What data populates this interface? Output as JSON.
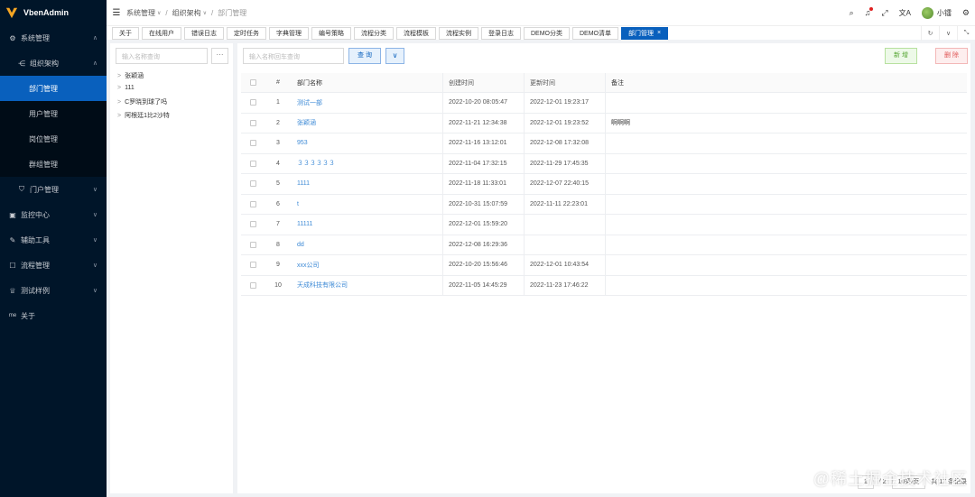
{
  "app": {
    "title": "VbenAdmin",
    "accent": "#0960bd",
    "sidebar_bg": "#001529"
  },
  "sidebar": {
    "items": [
      {
        "label": "系统管理",
        "icon": "gear-icon",
        "expanded": true
      },
      {
        "label": "组织架构",
        "icon": "org-icon",
        "expanded": true
      },
      {
        "label": "部门管理",
        "active": true
      },
      {
        "label": "用户管理"
      },
      {
        "label": "岗位管理"
      },
      {
        "label": "群组管理"
      },
      {
        "label": "门户管理",
        "icon": "shield-icon"
      },
      {
        "label": "监控中心",
        "icon": "monitor-icon"
      },
      {
        "label": "辅助工具",
        "icon": "tool-icon"
      },
      {
        "label": "流程管理",
        "icon": "flow-icon"
      },
      {
        "label": "测试样例",
        "icon": "trophy-icon"
      },
      {
        "label": "关于",
        "icon_text": "me"
      }
    ]
  },
  "header": {
    "breadcrumb": [
      "系统管理",
      "组织架构",
      "部门管理"
    ],
    "user_name": "小镭"
  },
  "tabs": [
    "关于",
    "在线用户",
    "错误日志",
    "定时任务",
    "字典管理",
    "编号策略",
    "流程分类",
    "流程模板",
    "流程实例",
    "登录日志",
    "DEMO分类",
    "DEMO清单",
    "部门管理"
  ],
  "active_tab": "部门管理",
  "tree": {
    "search_placeholder": "输入名称查询",
    "more_label": "···",
    "nodes": [
      "张颖涵",
      "111",
      "C罗晓到球了吗",
      "阿根廷1比2沙特"
    ]
  },
  "toolbar": {
    "search_placeholder": "输入名称回车查询",
    "query_label": "查 询",
    "expand_label": "∨",
    "add_label": "新 增",
    "delete_label": "删 除"
  },
  "table": {
    "columns": [
      "#",
      "部门名称",
      "创建时间",
      "更新时间",
      "备注"
    ],
    "rows": [
      {
        "idx": "1",
        "name": "测试一部",
        "created": "2022-10-20 08:05:47",
        "updated": "2022-12-01 19:23:17",
        "remark": ""
      },
      {
        "idx": "2",
        "name": "张颖涵",
        "created": "2022-11-21 12:34:38",
        "updated": "2022-12-01 19:23:52",
        "remark": "啊啊啊"
      },
      {
        "idx": "3",
        "name": "953",
        "created": "2022-11-16 13:12:01",
        "updated": "2022-12-08 17:32:08",
        "remark": ""
      },
      {
        "idx": "4",
        "name": "３３３３３３",
        "created": "2022-11-04 17:32:15",
        "updated": "2022-11-29 17:45:35",
        "remark": ""
      },
      {
        "idx": "5",
        "name": "1111",
        "created": "2022-11-18 11:33:01",
        "updated": "2022-12-07 22:40:15",
        "remark": ""
      },
      {
        "idx": "6",
        "name": "t",
        "created": "2022-10-31 15:07:59",
        "updated": "2022-11-11 22:23:01",
        "remark": ""
      },
      {
        "idx": "7",
        "name": "11111",
        "created": "2022-12-01 15:59:20",
        "updated": "",
        "remark": ""
      },
      {
        "idx": "8",
        "name": "dd",
        "created": "2022-12-08 16:29:36",
        "updated": "",
        "remark": ""
      },
      {
        "idx": "9",
        "name": "xxx公司",
        "created": "2022-10-20 15:56:46",
        "updated": "2022-12-01 10:43:54",
        "remark": ""
      },
      {
        "idx": "10",
        "name": "天成科技有限公司",
        "created": "2022-11-05 14:45:29",
        "updated": "2022-11-23 17:46:22",
        "remark": ""
      }
    ]
  },
  "pager": {
    "page": "1",
    "total_pages": "/ 2",
    "page_size": "10条/页",
    "total": "共 17 条记录"
  },
  "watermark": "@稀土掘金技术社区"
}
